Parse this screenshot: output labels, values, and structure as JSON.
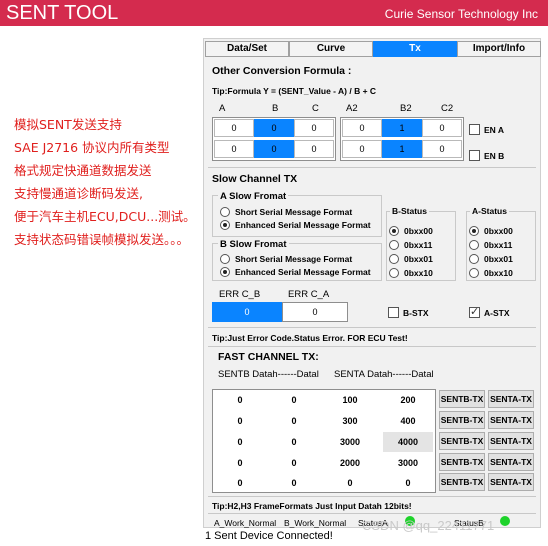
{
  "app": {
    "title": "SENT TOOL",
    "company": "Curie Sensor Technology Inc"
  },
  "promo_lines": [
    "模拟SENT发送支持",
    "SAE J2716 协议内所有类型",
    "格式规定快通道数据发送",
    "支持慢通道诊断码发送,",
    "便于汽车主机ECU,DCU...测试。",
    "支持状态码错误帧模拟发送。。。"
  ],
  "tabs": [
    "Data/Set",
    "Curve",
    "Tx",
    "Import/Info"
  ],
  "active_tab": "Tx",
  "conversion": {
    "title": "Other Conversion Formula :",
    "tip": "Tip:Formula  Y = (SENT_Value - A) / B + C",
    "left_headers": [
      "A",
      "B",
      "C"
    ],
    "right_headers": [
      "A2",
      "B2",
      "C2"
    ],
    "left_rows": [
      [
        "0",
        "0",
        "0"
      ],
      [
        "0",
        "0",
        "0"
      ]
    ],
    "right_rows": [
      [
        "0",
        "1",
        "0"
      ],
      [
        "0",
        "1",
        "0"
      ]
    ],
    "en_a": "EN A",
    "en_b": "EN B"
  },
  "slow": {
    "title": "Slow Channel TX",
    "a_title": "A Slow Fromat",
    "b_title": "B Slow Fromat",
    "opt_short": "Short Serial Message Format",
    "opt_enhanced": "Enhanced Serial Message  Format",
    "b_status_title": "B-Status",
    "a_status_title": "A-Status",
    "status_options": [
      "0bxx00",
      "0bxx11",
      "0bxx01",
      "0bxx10"
    ]
  },
  "err": {
    "cb_label": "ERR C_B",
    "ca_label": "ERR C_A",
    "cb_value": "0",
    "ca_value": "0",
    "b_stx": "B-STX",
    "a_stx": "A-STX",
    "tip": "Tip:Just Error Code.Status Error. FOR ECU Test!"
  },
  "fast": {
    "title": "FAST CHANNEL TX:",
    "sub_b": "SENTB Datah------Datal",
    "sub_a": "SENTA Datah------Datal",
    "rows": [
      [
        "0",
        "0",
        "100",
        "200"
      ],
      [
        "0",
        "0",
        "300",
        "400"
      ],
      [
        "0",
        "0",
        "3000",
        "4000"
      ],
      [
        "0",
        "0",
        "2000",
        "3000"
      ],
      [
        "0",
        "0",
        "0",
        "0"
      ]
    ],
    "btn_b": "SENTB-TX",
    "btn_a": "SENTA-TX",
    "tip": "Tip:H2,H3 FrameFormats Just Input Datah 12bits!"
  },
  "bottom": {
    "a_work": "A_Work_Normal",
    "b_work": "B_Work_Normal",
    "status_a": "StatusA",
    "status_b": "StatusB",
    "status_line": "1 Sent Device Connected!",
    "watermark": "CSDN @qq_22411771"
  }
}
